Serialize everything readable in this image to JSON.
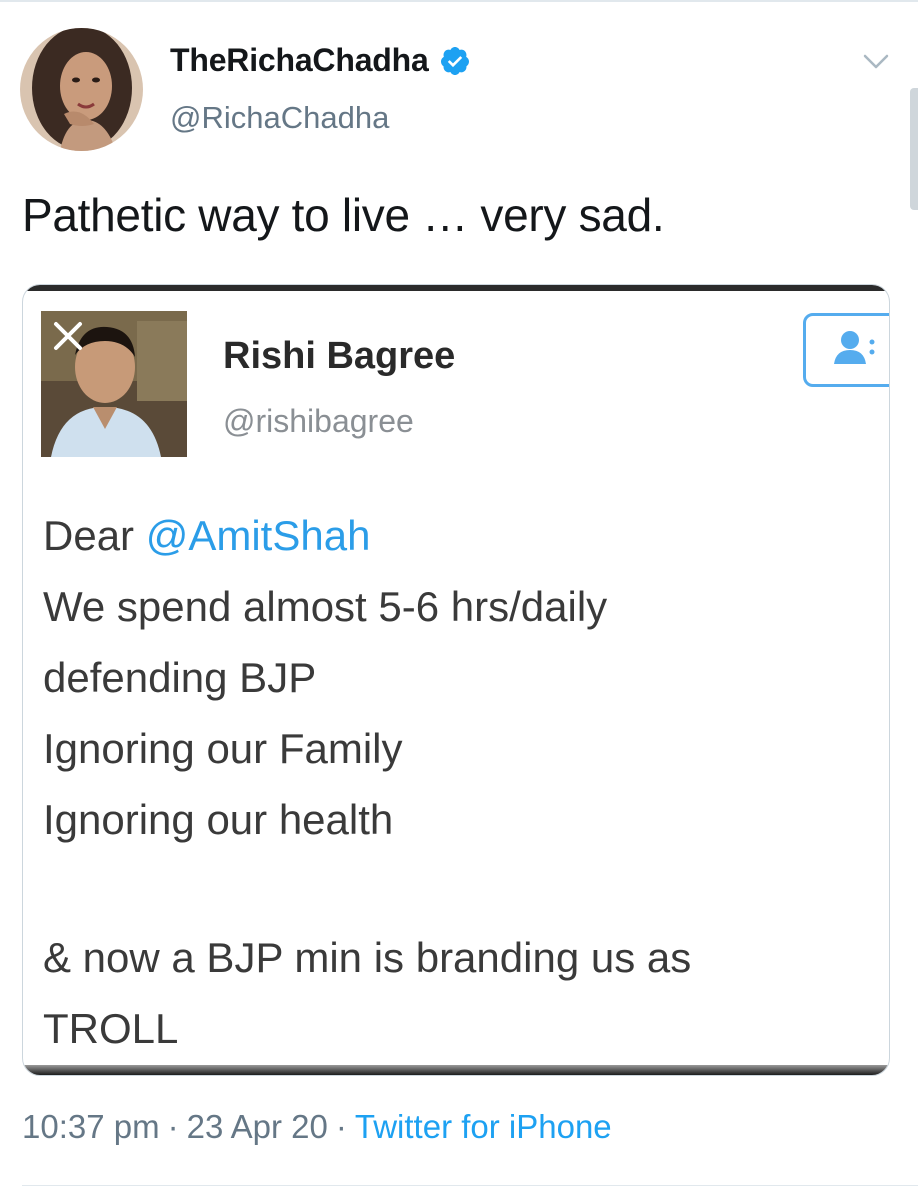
{
  "tweet": {
    "author": {
      "display_name": "TheRichaChadha",
      "handle": "@RichaChadha",
      "verified": true
    },
    "text": "Pathetic way to live … very sad.",
    "meta": {
      "time": "10:37 pm",
      "date": "23 Apr 20",
      "source": "Twitter for iPhone",
      "separator": "·"
    }
  },
  "embedded_image": {
    "author": {
      "display_name": "Rishi Bagree",
      "handle": "@rishibagree"
    },
    "body": {
      "greeting": "Dear ",
      "mention": "@AmitShah",
      "lines": [
        "We spend almost 5-6 hrs/daily",
        "defending BJP",
        "Ignoring our Family",
        "Ignoring our health"
      ],
      "closing_lines": [
        "& now a BJP min is branding us as",
        "TROLL"
      ]
    }
  },
  "icons": {
    "verified": "verified-badge-icon",
    "caret": "chevron-down-icon",
    "close": "close-icon",
    "follow": "follow-user-icon"
  },
  "colors": {
    "accent": "#1da1f2",
    "text_primary": "#14171a",
    "text_secondary": "#657786",
    "mention": "#2b9de8"
  }
}
